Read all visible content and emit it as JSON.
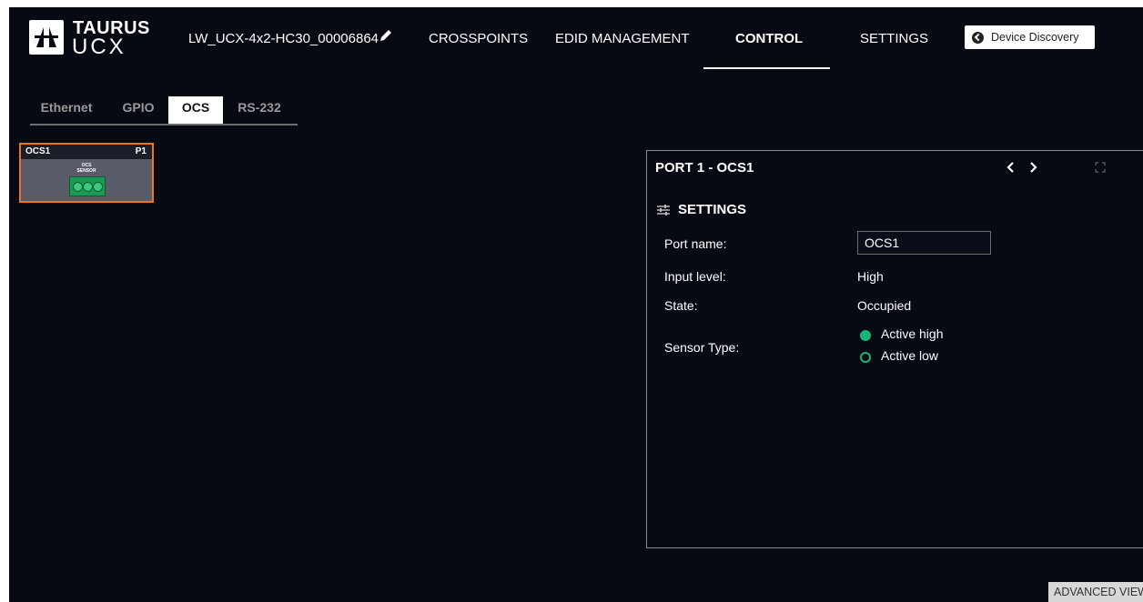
{
  "header": {
    "logo_line1": "TAURUS",
    "logo_line2": "UCX",
    "device_name": "LW_UCX-4x2-HC30_00006864",
    "nav": [
      {
        "label": "CROSSPOINTS"
      },
      {
        "label": "EDID MANAGEMENT"
      },
      {
        "label": "CONTROL",
        "active": true
      },
      {
        "label": "SETTINGS"
      }
    ],
    "discovery_label": "Device Discovery"
  },
  "subtabs": [
    {
      "label": "Ethernet"
    },
    {
      "label": "GPIO"
    },
    {
      "label": "OCS",
      "active": true
    },
    {
      "label": "RS-232"
    }
  ],
  "port_card": {
    "name": "OCS1",
    "number": "P1",
    "label_line1": "OCS",
    "label_line2": "SENSOR"
  },
  "panel": {
    "title": "PORT 1 - OCS1",
    "settings_title": "SETTINGS",
    "port_name_label": "Port name:",
    "port_name_value": "OCS1",
    "input_level_label": "Input level:",
    "input_level_value": "High",
    "state_label": "State:",
    "state_value": "Occupied",
    "sensor_type_label": "Sensor Type:",
    "sensor_options": [
      {
        "label": "Active high",
        "checked": true
      },
      {
        "label": "Active low",
        "checked": false
      }
    ]
  },
  "footer": {
    "advanced_label": "ADVANCED VIEW"
  },
  "colors": {
    "background": "#070a13",
    "accent_orange": "#e87722",
    "radio_green": "#19b47a"
  }
}
